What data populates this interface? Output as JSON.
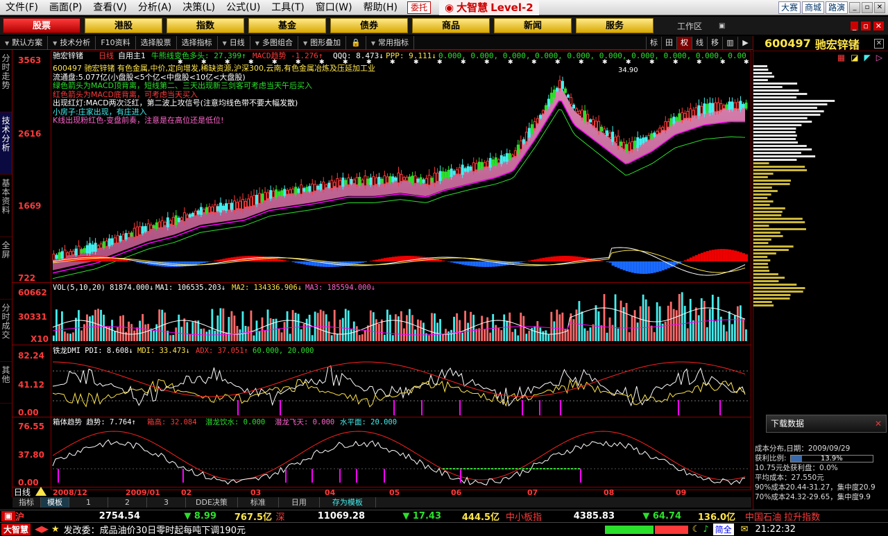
{
  "menu": [
    "文件(F)",
    "画面(P)",
    "查看(V)",
    "分析(A)",
    "决策(L)",
    "公式(U)",
    "工具(T)",
    "窗口(W)",
    "帮助(H)"
  ],
  "entrust": "委托",
  "brand": {
    "name": "大智慧",
    "level": "Level-2"
  },
  "right_links": [
    "大赛",
    "商城",
    "路演"
  ],
  "market_tabs": [
    "股票",
    "港股",
    "指数",
    "基金",
    "债券",
    "商品",
    "新闻",
    "服务"
  ],
  "workspace_label": "工作区",
  "toolbar": [
    "默认方案",
    "技术分析",
    "F10资料",
    "选择股票",
    "选择指标",
    "日线",
    "多图组合",
    "图形叠加",
    "常用指标"
  ],
  "toolbar_right": [
    "标",
    "田",
    "权",
    "线",
    "移",
    "",
    ""
  ],
  "side_tabs": [
    "分时走势",
    "技术分析",
    "基本资料",
    "全屏",
    "分时成交",
    "其他"
  ],
  "stock": {
    "code": "600497",
    "name": "驰宏锌锗"
  },
  "main_header": {
    "name": "驰宏锌锗",
    "period": "日线",
    "custom": "自用主1",
    "ind1": "牛熊线变色多头: 27.399↑",
    "ind2": "MACD趋势 -1.276↑",
    "ind3": "QQQ: 8.473↓",
    "ind4": "PPP: 9.111↓",
    "ind5": "0.000, 0.000, 0.000, 0.000, 0.000, 0.000, 0.000, 0.000, 0.000, 0.00"
  },
  "info_lines": [
    {
      "text": "600497 驰宏锌锗 有色金属,中价,定向增发,稀缺资源,沪深300,云南,有色金属冶炼及压延加工业",
      "color": "#ffe54a"
    },
    {
      "text": "流通盘:5.077亿(小盘股<5个亿<中盘股<10亿<大盘股)",
      "color": "#ffffff"
    },
    {
      "text": "绿色箭头为MACD顶背离，短线第二、三天出现新三剑客可考虑当天午后买入",
      "color": "#2be02b"
    },
    {
      "text": "红色箭头为MACD底背离，可考虑当天买入",
      "color": "#ff3a3a"
    },
    {
      "text": "出现红灯:MACD两次泛红，第二波上攻信号(注意均线色带不要大幅发散)",
      "color": "#ffffff"
    },
    {
      "text": "小房子:庄家出现，有庄进入",
      "color": "#4ee"
    },
    {
      "text": "K线出现粉红色-变盘前奏，注意是在高位还是低位!",
      "color": "#ff66cc"
    }
  ],
  "price_axis": [
    "3563",
    "2616",
    "1669",
    "722"
  ],
  "price_high_label": "34.90",
  "vol_header": {
    "a": "VOL(5,10,20) 81874.000↓",
    "b": "MA1: 106535.203↓",
    "c": "MA2: 134336.906↓",
    "d": "MA3: 185594.000↓"
  },
  "vol_axis": [
    "60662",
    "30331",
    "X10"
  ],
  "dmi_header": {
    "a": "铁龙DMI PDI: 8.608↓",
    "b": "MDI: 33.473↓",
    "c": "ADX: 37.051↑",
    "d": "60.000, 20.000"
  },
  "dmi_axis": [
    "82.24",
    "41.12",
    "0.00"
  ],
  "box_header": {
    "a": "箱体趋势 趋势: 7.764↑",
    "b": "箱高: 32.084",
    "c": "潜龙饮水: 0.000",
    "d": "潜龙飞天: 0.000",
    "e": "水平面: 20.000"
  },
  "box_axis": [
    "76.55",
    "37.80",
    "0.00"
  ],
  "date_labels": [
    "2008/12",
    "2009/01",
    "02",
    "03",
    "04",
    "05",
    "06",
    "07",
    "08",
    "09"
  ],
  "period_indicator": "日线",
  "bottom_tabs": [
    "指标",
    "模板",
    "1",
    "2",
    "3",
    "DDE决策",
    "标准",
    "日用",
    "存为模板"
  ],
  "ticker1": {
    "sh_label": "沪",
    "sh_val": "2754.54",
    "sh_chg": "▼ 8.99",
    "sh_amt": "767.5亿",
    "sz_label": "深",
    "sz_val": "11069.28",
    "sz_chg": "▼ 17.43",
    "sz_amt": "444.5亿",
    "mid_label": "中小板指",
    "mid_val": "4385.83",
    "mid_chg": "▼ 64.74",
    "mid_amt": "136.0亿",
    "news": "中国石油 拉升指数"
  },
  "ticker2": {
    "logo": "大智慧",
    "news": "发改委：成品油价30日零时起每吨下调190元",
    "qs": "简全",
    "time": "21:22:32"
  },
  "right_panel": {
    "download": "下载数据",
    "cost_title": "成本分布,日期：2009/09/29",
    "profit_label": "获利比例:",
    "profit_value": "13.9%",
    "profit_pct": 13.9,
    "line3": "10.75元处获利盘：0.0%",
    "line4": "平均成本：27.550元",
    "line5": "90%成本20.44-31.27，集中度20.9",
    "line6": "70%成本24.32-29.65，集中度9.9"
  }
}
